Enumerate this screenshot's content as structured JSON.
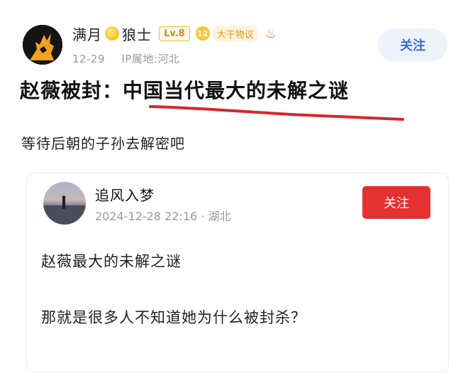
{
  "post": {
    "author": {
      "name_part1": "满月",
      "name_part2": "狼士",
      "level": "Lv.8",
      "badge_num": "12",
      "badge_text": "大干物议",
      "avatar_icon": "wolf-howling-icon"
    },
    "meta": {
      "date": "12-29",
      "location": "IP属地:河北"
    },
    "follow_label": "关注",
    "title_prefix": "赵薇被封：",
    "title_highlight": "中国当代最大的未解之谜",
    "body": "等待后朝的子孙去解密吧"
  },
  "quoted": {
    "author": {
      "name": "追风入梦"
    },
    "meta": {
      "datetime": "2024-12-28 22:16",
      "separator": "·",
      "location": "湖北"
    },
    "follow_label": "关注",
    "lines": [
      "赵薇最大的未解之谜",
      "那就是很多人不知道她为什么被封杀？"
    ]
  },
  "colors": {
    "accent_blue": "#3b6fd8",
    "follow_red": "#e5312f",
    "underline_red": "#d8262a",
    "level_orange": "#d98a1a"
  }
}
